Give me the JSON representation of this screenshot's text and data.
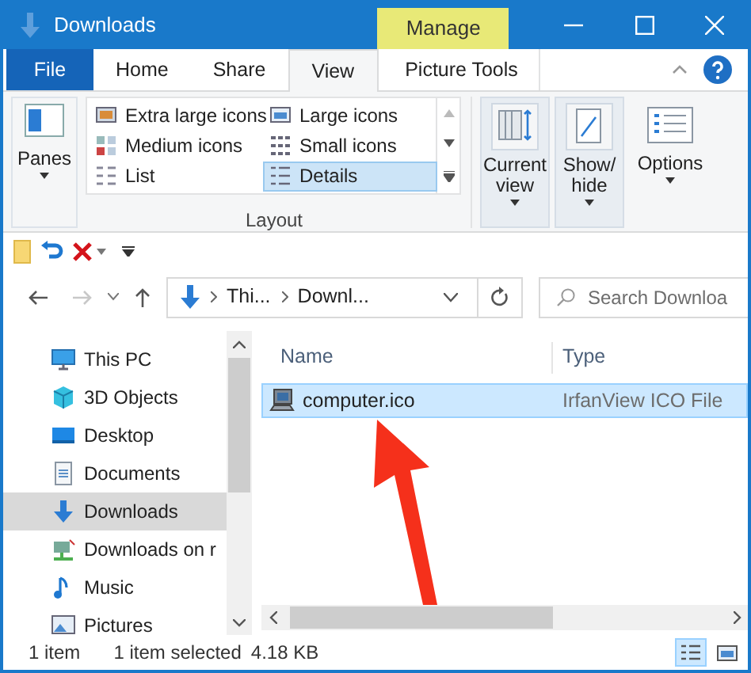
{
  "window": {
    "title": "Downloads",
    "context_tab": "Manage"
  },
  "tabs": [
    {
      "label": "File",
      "kind": "file",
      "selected": false
    },
    {
      "label": "Home",
      "kind": "tab",
      "selected": false
    },
    {
      "label": "Share",
      "kind": "tab",
      "selected": false
    },
    {
      "label": "View",
      "kind": "tab",
      "selected": true
    },
    {
      "label": "Picture Tools",
      "kind": "context",
      "selected": false
    }
  ],
  "ribbon": {
    "panes": "Panes",
    "layout_label": "Layout",
    "layout_options": [
      {
        "label": "Extra large icons",
        "kind": "xl",
        "selected": false
      },
      {
        "label": "Large icons",
        "kind": "large",
        "selected": false
      },
      {
        "label": "Medium icons",
        "kind": "medium",
        "selected": false
      },
      {
        "label": "Small icons",
        "kind": "small",
        "selected": false
      },
      {
        "label": "List",
        "kind": "list",
        "selected": false
      },
      {
        "label": "Details",
        "kind": "details",
        "selected": true
      }
    ],
    "buttons": [
      {
        "label": "Current view",
        "kind": "current"
      },
      {
        "label": "Show/ hide",
        "kind": "showhide"
      },
      {
        "label": "Options",
        "kind": "options"
      }
    ]
  },
  "address": {
    "crumbs": [
      "Thi...",
      "Downl..."
    ],
    "search_placeholder": "Search Downloa"
  },
  "nav": [
    {
      "label": "This PC",
      "kind": "pc",
      "selected": false
    },
    {
      "label": "3D Objects",
      "kind": "cube",
      "selected": false
    },
    {
      "label": "Desktop",
      "kind": "desktop",
      "selected": false
    },
    {
      "label": "Documents",
      "kind": "documents",
      "selected": false
    },
    {
      "label": "Downloads",
      "kind": "download",
      "selected": true
    },
    {
      "label": "Downloads on r",
      "kind": "network",
      "selected": false
    },
    {
      "label": "Music",
      "kind": "music",
      "selected": false
    },
    {
      "label": "Pictures",
      "kind": "pictures",
      "selected": false
    }
  ],
  "table": {
    "columns": [
      "Name",
      "Type"
    ],
    "rows": [
      {
        "name": "computer.ico",
        "type": "IrfanView ICO File",
        "selected": true
      }
    ]
  },
  "status_bar": {
    "count": "1 item",
    "selection": "1 item selected",
    "size": "4.18 KB",
    "views": [
      {
        "kind": "details",
        "selected": true
      },
      {
        "kind": "thumbs",
        "selected": false
      }
    ]
  }
}
